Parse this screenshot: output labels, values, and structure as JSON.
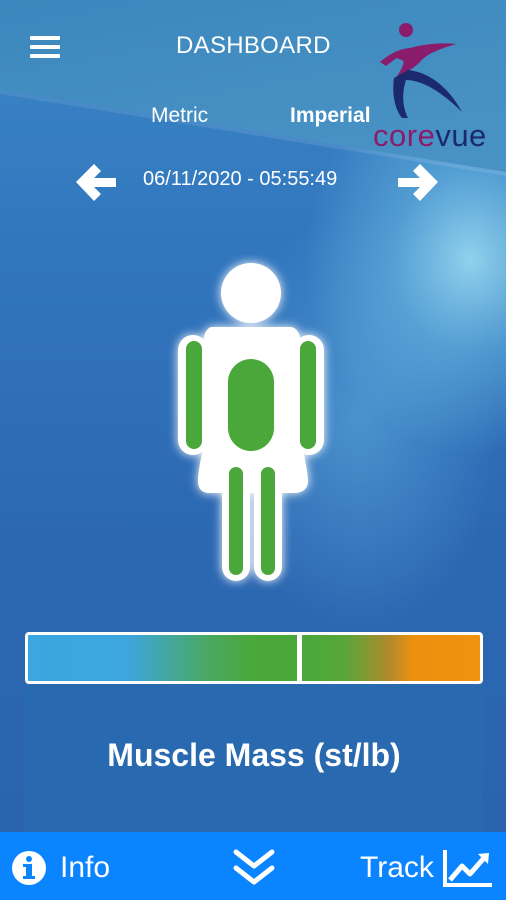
{
  "header": {
    "title": "DASHBOARD",
    "menu_icon": "hamburger-menu-icon"
  },
  "logo": {
    "text_part1": "core",
    "text_part2": "vue",
    "colors": {
      "figure": "#8a1d6b",
      "swoosh": "#1a2a6c"
    }
  },
  "units": {
    "metric_label": "Metric",
    "imperial_label": "Imperial",
    "selected": "Imperial"
  },
  "date_nav": {
    "datetime": "06/11/2020 - 05:55:49",
    "prev_icon": "arrow-left-icon",
    "next_icon": "arrow-right-icon"
  },
  "body_figure": {
    "type": "female",
    "highlight_color": "#4aa83a",
    "highlighted_segments": [
      "left-arm",
      "right-arm",
      "trunk",
      "left-leg",
      "right-leg"
    ]
  },
  "gauge": {
    "colors": [
      "#3ba6df",
      "#4aa83a",
      "#f0920e"
    ],
    "marker_fraction": 0.6
  },
  "card": {
    "title": "Muscle Mass (st/lb)"
  },
  "bottom_bar": {
    "info_label": "Info",
    "info_icon": "info-icon",
    "expand_icon": "chevron-double-down-icon",
    "track_label": "Track",
    "track_icon": "trend-chart-icon",
    "color": "#0a84ff"
  }
}
